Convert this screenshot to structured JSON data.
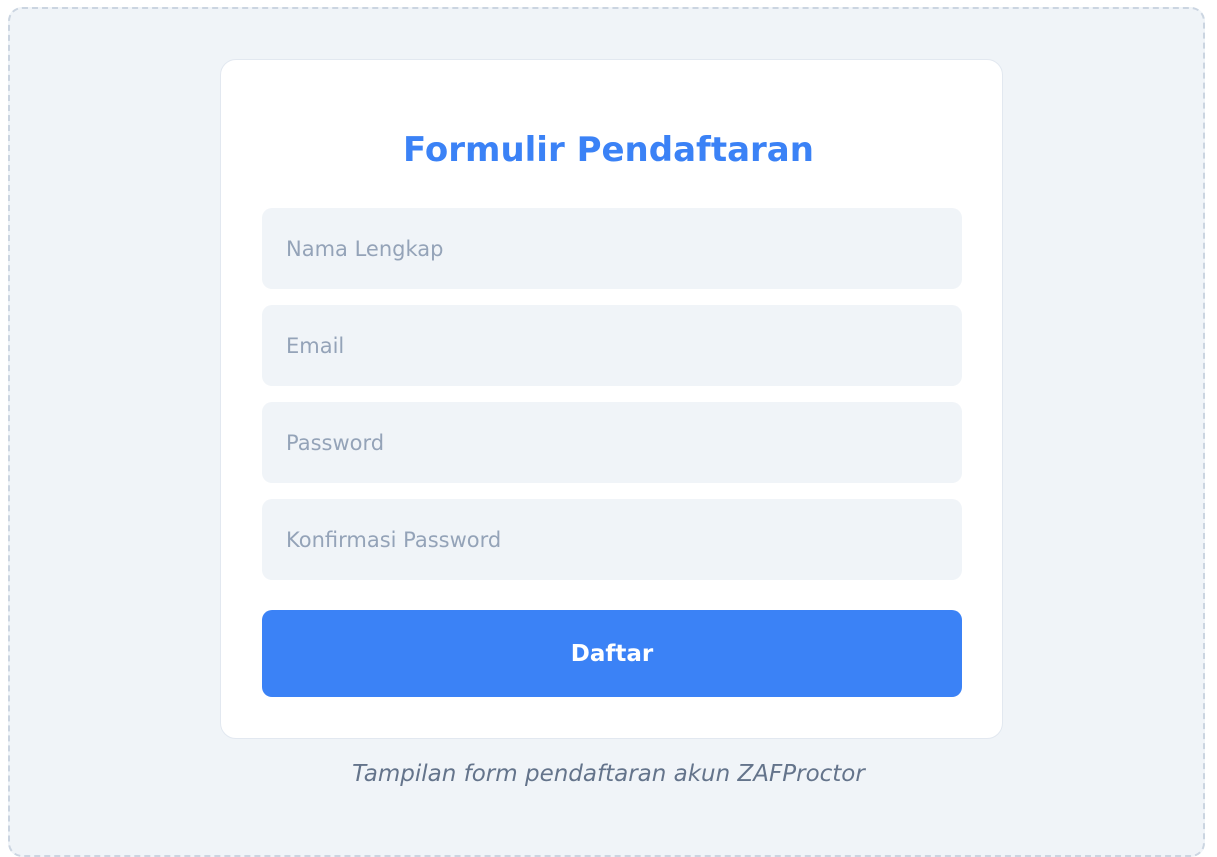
{
  "form": {
    "title": "Formulir Pendaftaran",
    "fields": [
      {
        "placeholder": "Nama Lengkap",
        "value": ""
      },
      {
        "placeholder": "Email",
        "value": ""
      },
      {
        "placeholder": "Password",
        "value": ""
      },
      {
        "placeholder": "Konfirmasi Password",
        "value": ""
      }
    ],
    "submit_label": "Daftar"
  },
  "caption": "Tampilan form pendaftaran akun ZAFProctor",
  "colors": {
    "accent": "#3b82f6",
    "background": "#f0f4f8",
    "card": "#ffffff",
    "placeholder": "#94a3b8",
    "caption": "#64748b"
  }
}
